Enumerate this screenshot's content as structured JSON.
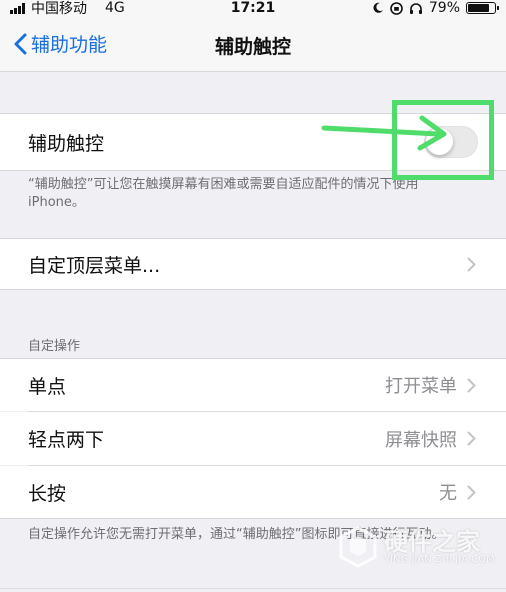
{
  "status_bar": {
    "carrier": "中国移动",
    "network": "4G",
    "time": "17:21",
    "battery": "79%",
    "battery_level": 0.79
  },
  "nav": {
    "back_label": "辅助功能",
    "title": "辅助触控"
  },
  "assistive_touch": {
    "label": "辅助触控",
    "enabled": false,
    "footer": "“辅助触控”可让您在触摸屏幕有困难或需要自适应配件的情况下使用 iPhone。"
  },
  "customize_menu": {
    "label": "自定顶层菜单..."
  },
  "custom_actions": {
    "header": "自定操作",
    "items": [
      {
        "label": "单点",
        "value": "打开菜单"
      },
      {
        "label": "轻点两下",
        "value": "屏幕快照"
      },
      {
        "label": "长按",
        "value": "无"
      }
    ],
    "footer": "自定操作允许您无需打开菜单，通过“辅助触控”图标即可直接进行互动。"
  },
  "annotation": {
    "color": "#4fdc6a"
  },
  "watermark": {
    "title": "硬件之家",
    "subtitle": "YING JIAN ZHI JIA.COM"
  },
  "colors": {
    "accent": "#1a6fe0",
    "background": "#efeff4"
  }
}
